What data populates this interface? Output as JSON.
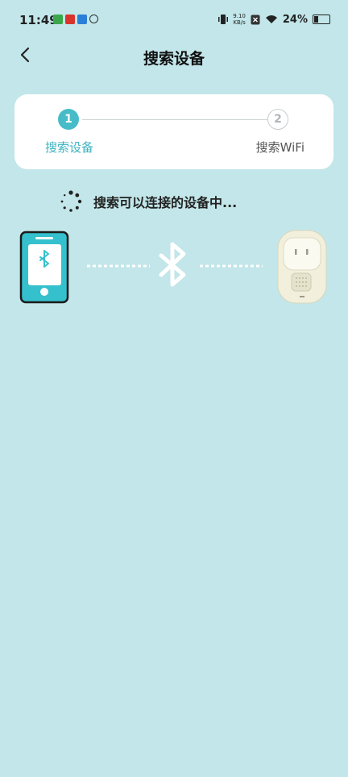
{
  "status_bar": {
    "time": "11:49",
    "net_speed_value": "9.10",
    "net_speed_unit": "KB/s",
    "battery": "24%"
  },
  "header": {
    "title": "搜索设备"
  },
  "stepper": {
    "steps": [
      {
        "number": "1",
        "label": "搜索设备",
        "active": true
      },
      {
        "number": "2",
        "label": "搜索WiFi",
        "active": false
      }
    ]
  },
  "searching_text": "搜索可以连接的设备中...",
  "colors": {
    "background": "#c2e6e9",
    "accent": "#47bcc8",
    "phone_body": "#34c0cc"
  }
}
